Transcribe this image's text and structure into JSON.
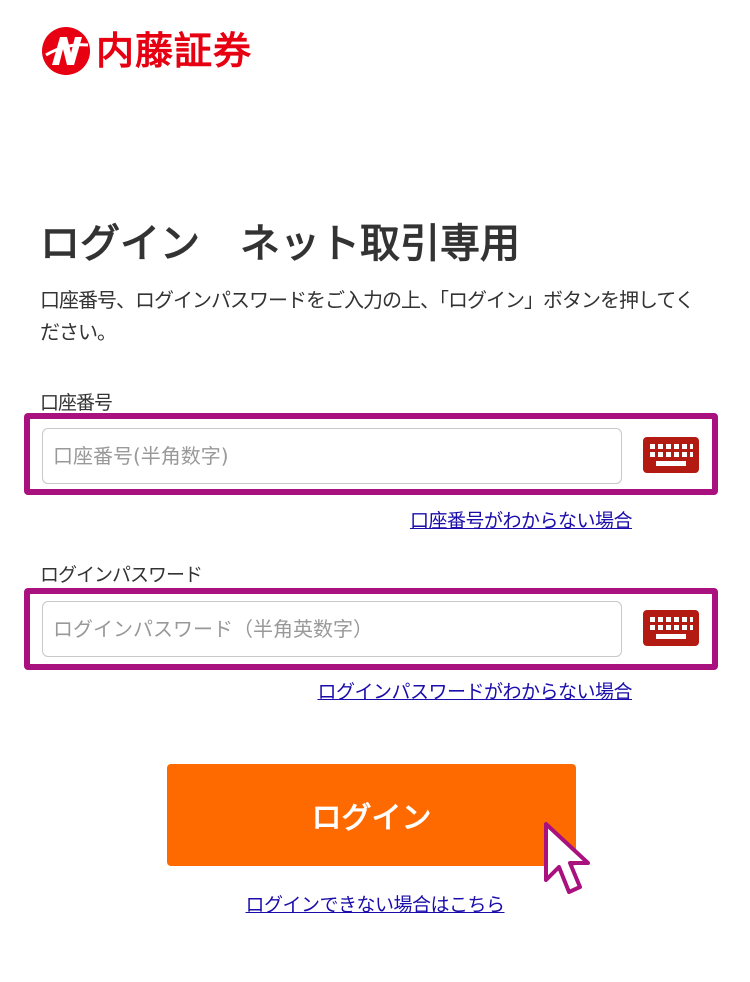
{
  "brand": {
    "name": "内藤証券",
    "color": "#e60012",
    "logo_icon": "naito-logo-icon"
  },
  "page": {
    "title": "ログイン　ネット取引専用",
    "description": "口座番号、ログインパスワードをご入力の上、「ログイン」ボタンを押してください。"
  },
  "account": {
    "label": "口座番号",
    "placeholder": "口座番号(半角数字)",
    "value": "",
    "help_link": "口座番号がわからない場合"
  },
  "password": {
    "label": "ログインパスワード",
    "placeholder": "ログインパスワード（半角英数字）",
    "value": "",
    "help_link": "ログインパスワードがわからない場合"
  },
  "login_button": {
    "label": "ログイン",
    "color": "#ff6a00"
  },
  "help": {
    "cannot_login_link": "ログインできない場合はこちら"
  },
  "icons": {
    "keyboard": "keyboard-icon",
    "pointer": "pointer-cursor-icon"
  },
  "colors": {
    "highlight": "#a8117e",
    "link": "#1a0dab",
    "keyboard_icon": "#b31b12"
  }
}
